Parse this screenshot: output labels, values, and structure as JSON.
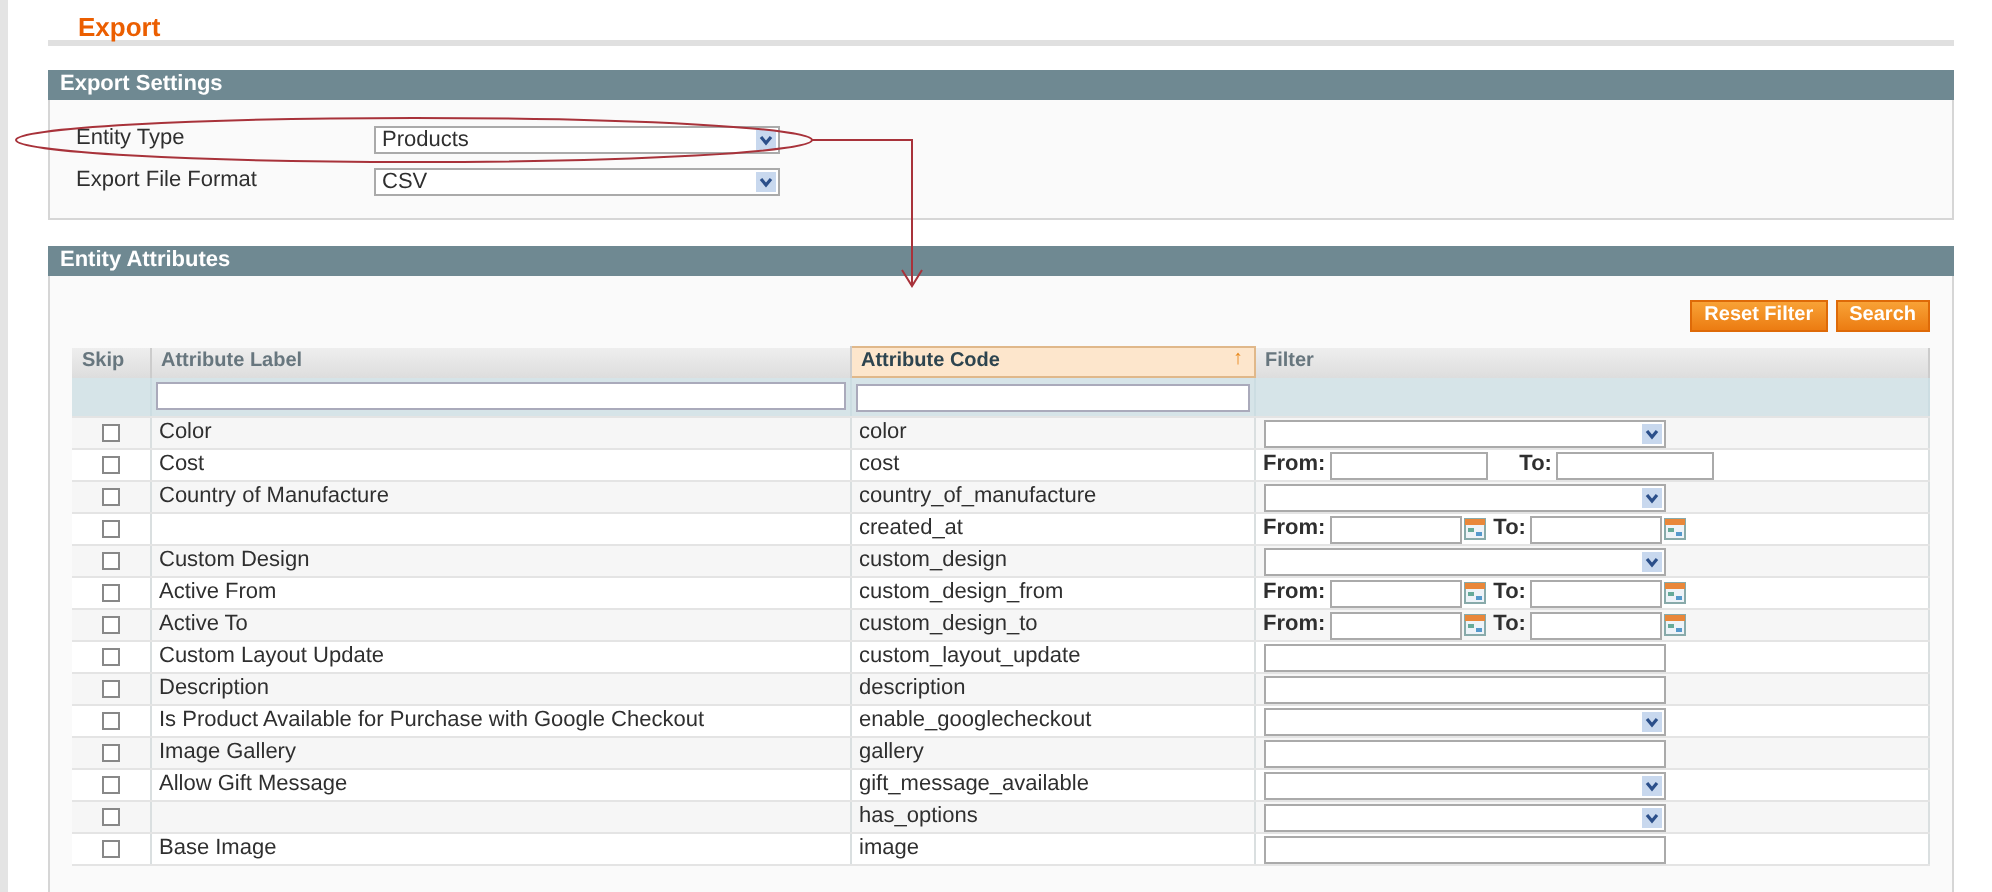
{
  "page_title": "Export",
  "export_settings": {
    "title": "Export Settings",
    "fields": [
      {
        "label": "Entity Type",
        "value": "Products"
      },
      {
        "label": "Export File Format",
        "value": "CSV"
      }
    ]
  },
  "entity_attributes": {
    "title": "Entity Attributes",
    "buttons": [
      "Reset Filter",
      "Search"
    ],
    "columns": [
      {
        "label": "Skip",
        "sorted": false,
        "filter_field": false
      },
      {
        "label": "Attribute Label",
        "sorted": false,
        "filter_field": true
      },
      {
        "label": "Attribute Code",
        "sorted": true,
        "sort_arrow": "↑",
        "filter_field": true
      },
      {
        "label": "Filter",
        "sorted": false,
        "filter_field": false
      }
    ],
    "rows": [
      {
        "checked": false,
        "label": "Color",
        "code": "color",
        "filter": {
          "kind": "select"
        }
      },
      {
        "checked": false,
        "label": "Cost",
        "code": "cost",
        "filter": {
          "kind": "range",
          "from_label": "From:",
          "to_label": "To:"
        }
      },
      {
        "checked": false,
        "label": "Country of Manufacture",
        "code": "country_of_manufacture",
        "filter": {
          "kind": "select"
        }
      },
      {
        "checked": false,
        "code": "created_at",
        "filter": {
          "kind": "date_range",
          "from_label": "From:",
          "to_label": "To:"
        }
      },
      {
        "checked": false,
        "label": "Custom Design",
        "code": "custom_design",
        "filter": {
          "kind": "select"
        }
      },
      {
        "checked": false,
        "label": "Active From",
        "code": "custom_design_from",
        "filter": {
          "kind": "date_range",
          "from_label": "From:",
          "to_label": "To:"
        }
      },
      {
        "checked": false,
        "label": "Active To",
        "code": "custom_design_to",
        "filter": {
          "kind": "date_range",
          "from_label": "From:",
          "to_label": "To:"
        }
      },
      {
        "checked": false,
        "label": "Custom Layout Update",
        "code": "custom_layout_update",
        "filter": {
          "kind": "text"
        }
      },
      {
        "checked": false,
        "label": "Description",
        "code": "description",
        "filter": {
          "kind": "text"
        }
      },
      {
        "checked": false,
        "label": "Is Product Available for Purchase with Google Checkout",
        "code": "enable_googlecheckout",
        "filter": {
          "kind": "select"
        }
      },
      {
        "checked": false,
        "label": "Image Gallery",
        "code": "gallery",
        "filter": {
          "kind": "text"
        }
      },
      {
        "checked": false,
        "label": "Allow Gift Message",
        "code": "gift_message_available",
        "filter": {
          "kind": "select"
        }
      },
      {
        "checked": false,
        "code": "has_options",
        "filter": {
          "kind": "select"
        }
      },
      {
        "checked": false,
        "label": "Base Image",
        "code": "image",
        "filter": {
          "kind": "text"
        }
      }
    ]
  }
}
